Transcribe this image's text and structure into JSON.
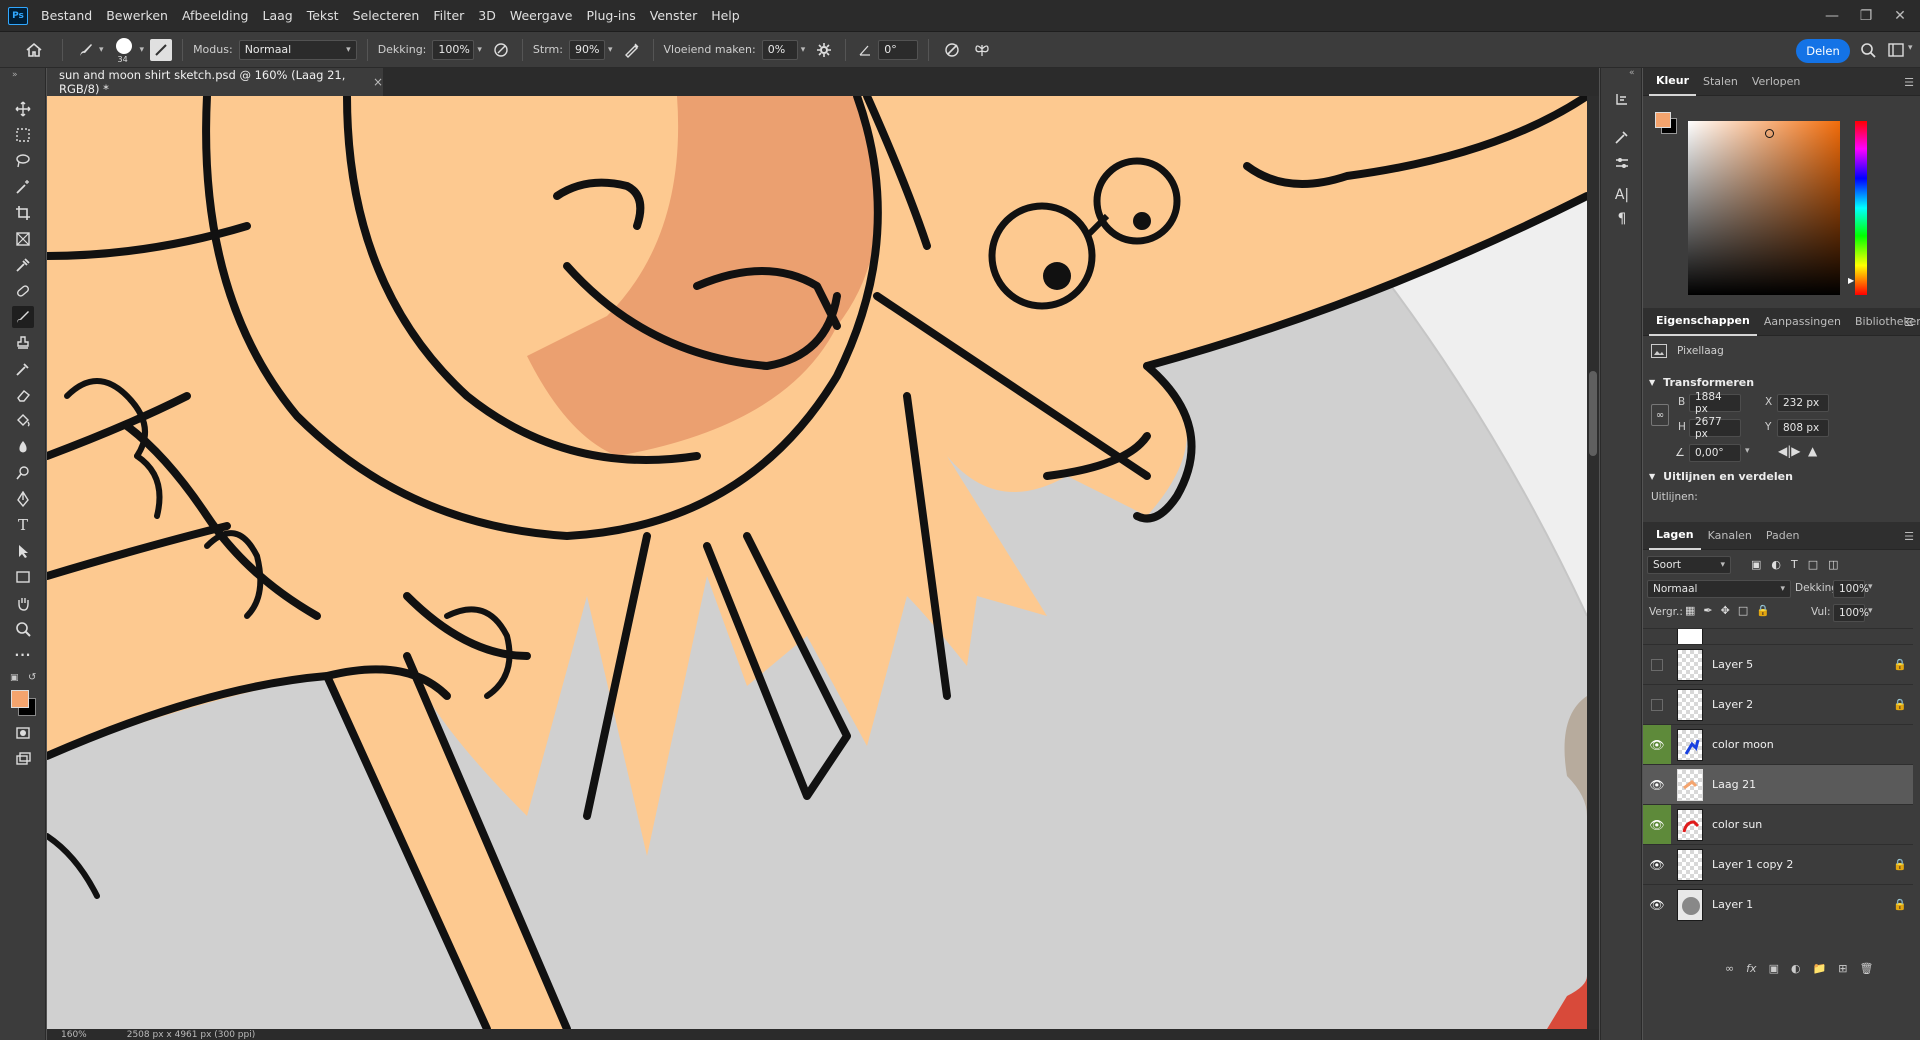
{
  "menubar": {
    "app_logo": "Ps",
    "items": [
      "Bestand",
      "Bewerken",
      "Afbeelding",
      "Laag",
      "Tekst",
      "Selecteren",
      "Filter",
      "3D",
      "Weergave",
      "Plug-ins",
      "Venster",
      "Help"
    ],
    "window_controls": [
      "minimize-icon",
      "restore-icon",
      "close-icon"
    ]
  },
  "options": {
    "brush_size": "34",
    "mode_label": "Modus:",
    "mode_value": "Normaal",
    "opacity_label": "Dekking:",
    "opacity_value": "100%",
    "flow_label": "Strm:",
    "flow_value": "90%",
    "smoothing_label": "Vloeiend maken:",
    "smoothing_value": "0%",
    "angle_value": "0°",
    "share_label": "Delen"
  },
  "document": {
    "tab_title": "sun and moon shirt sketch.psd @ 160% (Laag 21, RGB/8) *",
    "status_zoom": "160%",
    "status_info": "2508 px x 4961 px (300 ppi)"
  },
  "colors": {
    "foreground": "#f4a46e",
    "background": "#000000",
    "skin": "#fdc990",
    "cheek": "#eba070",
    "accent": "#1473e6",
    "layer_visible_green": "#5e8a3a"
  },
  "color_panel": {
    "tabs": [
      "Kleur",
      "Stalen",
      "Verlopen"
    ],
    "active_tab": "Kleur"
  },
  "properties_panel": {
    "tabs": [
      "Eigenschappen",
      "Aanpassingen",
      "Bibliotheken"
    ],
    "active_tab": "Eigenschappen",
    "layer_type": "Pixellaag",
    "transform_title": "Transformeren",
    "w_label": "B",
    "w_value": "1884 px",
    "h_label": "H",
    "h_value": "2677 px",
    "x_label": "X",
    "x_value": "232 px",
    "y_label": "Y",
    "y_value": "808 px",
    "rotation_value": "0,00°",
    "align_title": "Uitlijnen en verdelen",
    "align_label": "Uitlijnen:"
  },
  "layers_panel": {
    "tabs": [
      "Lagen",
      "Kanalen",
      "Paden"
    ],
    "active_tab": "Lagen",
    "filter_label": "Soort",
    "blend_mode": "Normaal",
    "opacity_label": "Dekking:",
    "opacity_value": "100%",
    "lock_label": "Vergr.:",
    "fill_label": "Vul:",
    "fill_value": "100%",
    "layers": [
      {
        "name": "Layer 5",
        "visible": false,
        "locked": true,
        "green": false,
        "selected": false
      },
      {
        "name": "Layer 2",
        "visible": false,
        "locked": true,
        "green": false,
        "selected": false
      },
      {
        "name": "color moon",
        "visible": true,
        "locked": false,
        "green": true,
        "selected": false
      },
      {
        "name": "Laag 21",
        "visible": true,
        "locked": false,
        "green": false,
        "selected": true
      },
      {
        "name": "color sun",
        "visible": true,
        "locked": false,
        "green": true,
        "selected": false
      },
      {
        "name": "Layer 1 copy 2",
        "visible": true,
        "locked": true,
        "green": false,
        "selected": false
      },
      {
        "name": "Layer 1",
        "visible": true,
        "locked": true,
        "green": false,
        "selected": false
      }
    ],
    "footer_icons": [
      "link-icon",
      "fx-icon",
      "mask-icon",
      "adjustment-icon",
      "group-icon",
      "new-layer-icon",
      "trash-icon"
    ]
  }
}
